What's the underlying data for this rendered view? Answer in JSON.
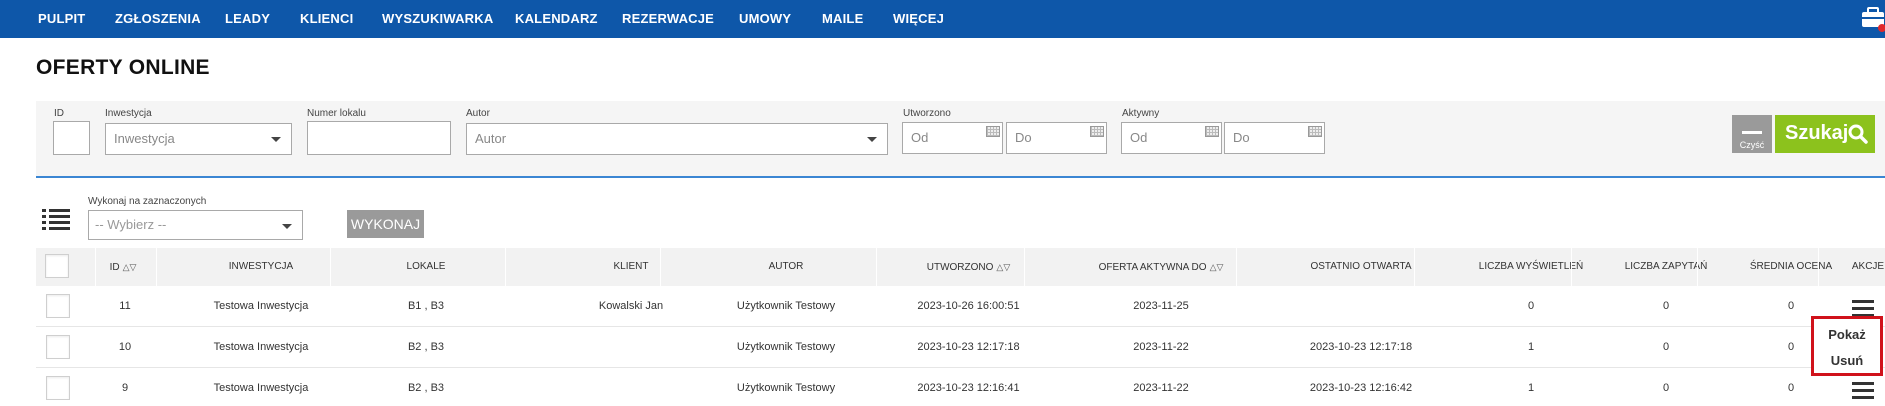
{
  "nav": {
    "items": [
      "PULPIT",
      "ZGŁOSZENIA",
      "LEADY",
      "KLIENCI",
      "WYSZUKIWARKA",
      "KALENDARZ",
      "REZERWACJE",
      "UMOWY",
      "MAILE",
      "WIĘCEJ"
    ],
    "bar_color": "#0e57a9"
  },
  "page_title": "OFERTY ONLINE",
  "filters": {
    "id": {
      "label": "ID",
      "value": ""
    },
    "inwestycja": {
      "label": "Inwestycja",
      "placeholder": "Inwestycja"
    },
    "numer_lokalu": {
      "label": "Numer lokalu",
      "value": ""
    },
    "autor": {
      "label": "Autor",
      "placeholder": "Autor"
    },
    "utworzono": {
      "label": "Utworzono",
      "from": "Od",
      "to": "Do"
    },
    "aktywny": {
      "label": "Aktywny",
      "from": "Od",
      "to": "Do"
    },
    "clear_label": "Czyść",
    "search_label": "Szukaj",
    "search_color": "#8cc21d"
  },
  "bulk": {
    "label": "Wykonaj na zaznaczonych",
    "placeholder": "-- Wybierz --",
    "run_label": "WYKONAJ"
  },
  "table": {
    "headers": {
      "id": "ID",
      "inwestycja": "INWESTYCJA",
      "lokale": "LOKALE",
      "klient": "KLIENT",
      "autor": "AUTOR",
      "utworzono": "UTWORZONO",
      "oferta_aktywna_do": "OFERTA AKTYWNA DO",
      "ostatnio_otwarta": "OSTATNIO OTWARTA",
      "liczba_wyswietlen": "LICZBA WYŚWIETLEŃ",
      "liczba_zapytan": "LICZBA ZAPYTAŃ",
      "srednia_ocena": "ŚREDNIA OCENA",
      "akcje": "AKCJE"
    },
    "rows": [
      {
        "id": "11",
        "inwestycja": "Testowa Inwestycja",
        "lokale": "B1 , B3",
        "klient": "Kowalski Jan",
        "autor": "Użytkownik Testowy",
        "utworzono": "2023-10-26 16:00:51",
        "aktywna_do": "2023-11-25",
        "ostatnio_otwarta": "",
        "wyswietlenia": "0",
        "zapytania": "0",
        "ocena": "0"
      },
      {
        "id": "10",
        "inwestycja": "Testowa Inwestycja",
        "lokale": "B2 , B3",
        "klient": "",
        "autor": "Użytkownik Testowy",
        "utworzono": "2023-10-23 12:17:18",
        "aktywna_do": "2023-11-22",
        "ostatnio_otwarta": "2023-10-23 12:17:18",
        "wyswietlenia": "1",
        "zapytania": "0",
        "ocena": "0"
      },
      {
        "id": "9",
        "inwestycja": "Testowa Inwestycja",
        "lokale": "B2 , B3",
        "klient": "",
        "autor": "Użytkownik Testowy",
        "utworzono": "2023-10-23 12:16:41",
        "aktywna_do": "2023-11-22",
        "ostatnio_otwarta": "2023-10-23 12:16:42",
        "wyswietlenia": "1",
        "zapytania": "0",
        "ocena": "0"
      }
    ]
  },
  "context_menu": {
    "items": [
      "Pokaż",
      "Usuń"
    ],
    "highlight_color": "#d0121b"
  }
}
